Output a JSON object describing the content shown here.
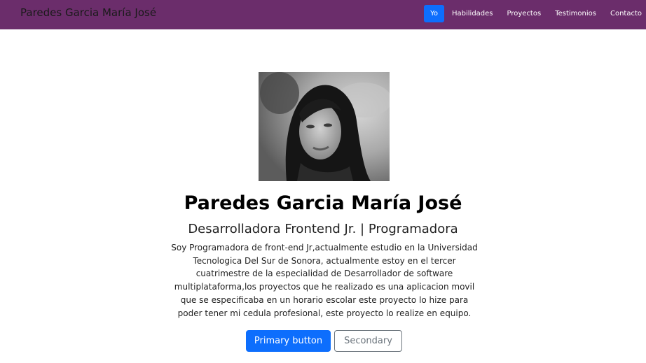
{
  "navbar": {
    "brand": "Paredes Garcia María José",
    "links": [
      {
        "label": "Yo",
        "active": true
      },
      {
        "label": "Habilidades",
        "active": false
      },
      {
        "label": "Proyectos",
        "active": false
      },
      {
        "label": "Testimonios",
        "active": false
      },
      {
        "label": "Contacto",
        "active": false
      }
    ],
    "colors": {
      "background": "#6b2d6b",
      "active": "#0d6efd"
    }
  },
  "hero": {
    "name": "Paredes Garcia María José",
    "role": "Desarrolladora Frontend Jr. | Programadora",
    "bio_lines": [
      "Soy Programadora de front-end Jr,actualmente estudio en la Universidad",
      "Tecnologica Del Sur de Sonora, actualmente estoy en el tercer",
      "cuatrimestre de la especialidad de Desarrollador de software",
      "multiplataforma,los proyectos que he realizado es una aplicacion movil",
      "que se especificaba en un horario escolar este proyecto lo hize para",
      "poder tener mi cedula profesional, este proyecto lo realize en equipo."
    ],
    "primary_button": "Primary button",
    "secondary_button": "Secondary"
  }
}
